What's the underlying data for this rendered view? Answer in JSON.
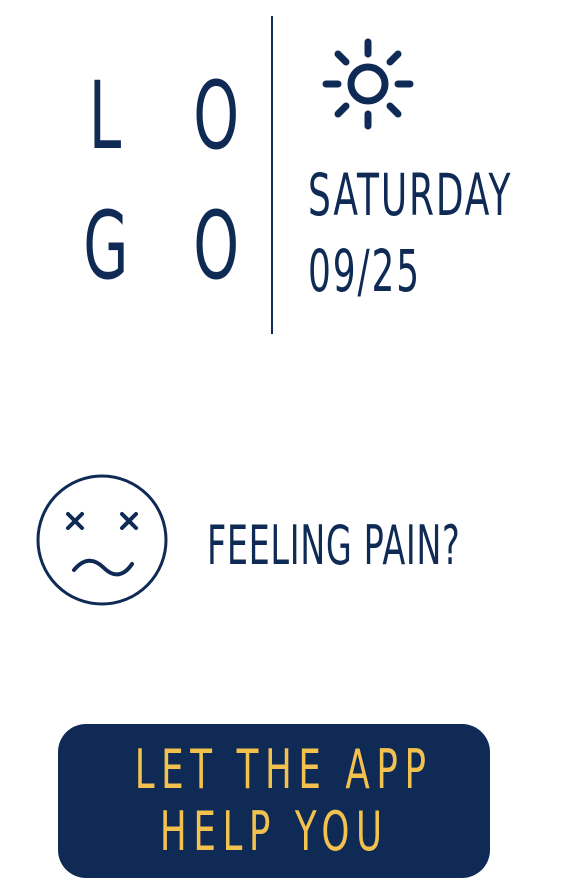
{
  "logo": {
    "letters": [
      "L",
      "O",
      "G",
      "O"
    ]
  },
  "weather": {
    "icon": "sun-icon",
    "day": "SATURDAY",
    "date": "09/25"
  },
  "prompt": {
    "icon": "dizzy-face-icon",
    "question": "FEELING PAIN?"
  },
  "cta": {
    "line1": "LET THE APP",
    "line2": "HELP YOU"
  },
  "colors": {
    "navy": "#0f2a55",
    "gold": "#f2c14e",
    "background": "#ffffff"
  }
}
